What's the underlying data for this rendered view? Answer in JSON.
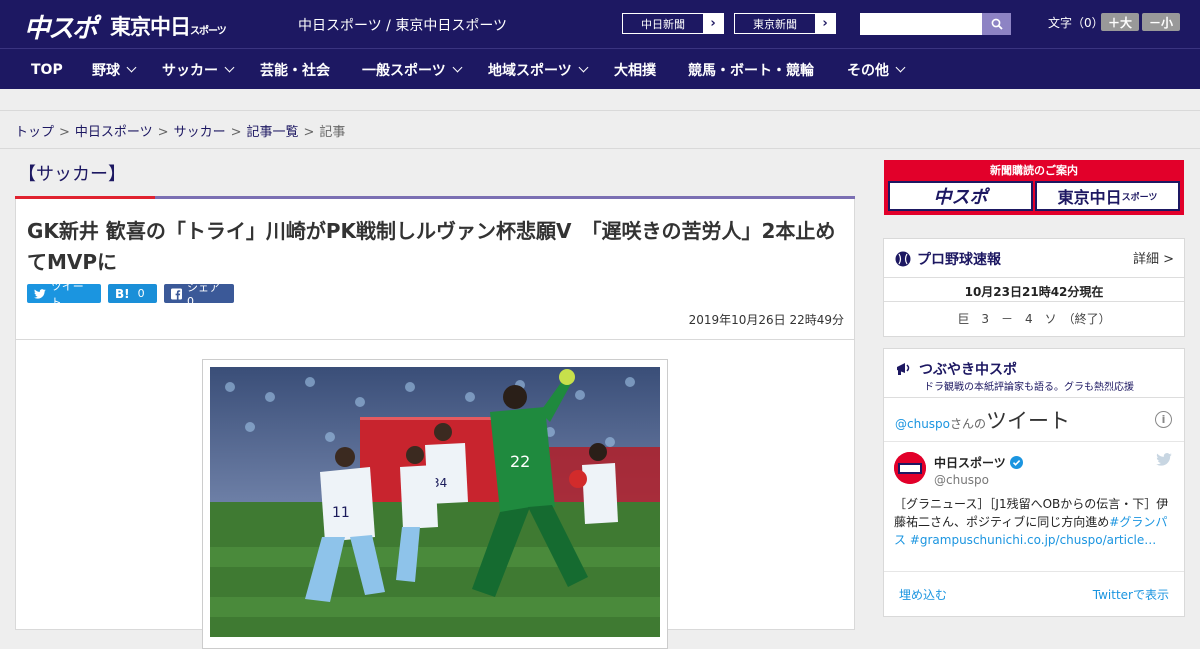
{
  "header": {
    "logo_chuspo": "中スポ",
    "logo_tokyo": "東京中日",
    "logo_tokyo_small": "スポーツ",
    "site_name": "中日スポーツ / 東京中日スポーツ",
    "ext_links": [
      {
        "label": "中日新聞"
      },
      {
        "label": "東京新聞"
      }
    ],
    "search_placeholder": "",
    "font_size_label": "文字（0）",
    "font_larger": "＋大",
    "font_smaller": "－小",
    "arrow_glyph": "›"
  },
  "nav": [
    {
      "label": "TOP",
      "has_menu": false
    },
    {
      "label": "野球",
      "has_menu": true
    },
    {
      "label": "サッカー",
      "has_menu": true
    },
    {
      "label": "芸能・社会",
      "has_menu": false
    },
    {
      "label": "一般スポーツ",
      "has_menu": true
    },
    {
      "label": "地域スポーツ",
      "has_menu": true
    },
    {
      "label": "大相撲",
      "has_menu": false
    },
    {
      "label": "競馬・ボート・競輪",
      "has_menu": false
    },
    {
      "label": "その他",
      "has_menu": true
    }
  ],
  "breadcrumb": {
    "items": [
      "トップ",
      "中日スポーツ",
      "サッカー",
      "記事一覧"
    ],
    "current": "記事",
    "separator": ">"
  },
  "article": {
    "category": "【サッカー】",
    "headline": "GK新井 歓喜の「トライ」川崎がPK戦制しルヴァン杯悲願V　「遅咲きの苦労人」2本止めてMVPに",
    "share": {
      "tweet": "ツイート",
      "hatena_count": "0",
      "facebook": "シェア 0"
    },
    "date": "2019年10月26日 22時49分"
  },
  "sidebar": {
    "ad": {
      "title": "新聞購読のご案内",
      "chuspo": "中スポ",
      "tokyo": "東京中日",
      "tokyo_small": "スポーツ"
    },
    "baseball": {
      "title": "プロ野球速報",
      "more": "詳細 >",
      "time": "10月23日21時42分現在",
      "score": "巨　3　－　4　ソ　（終了）"
    },
    "tweets": {
      "title": "つぶやき中スポ",
      "subtitle": "ドラ観戦の本紙評論家も語る。グラも熱烈応援",
      "handle_prefix": "@chuspo",
      "handle_suffix": "さんの",
      "big_label": "ツイート",
      "info_glyph": "i",
      "user_name": "中日スポーツ",
      "user_handle": "@chuspo",
      "text_plain": "［グラニュース］［J1残留へOBからの伝言・下］伊藤祐二さん、ポジティブに同じ方向進め",
      "text_link": "#グランパス #grampuschunichi.co.jp/chuspo/article…",
      "embed": "埋め込む",
      "view_on": "Twitterで表示"
    }
  },
  "colors": {
    "navy": "#1d1862",
    "red": "#e2002a",
    "twitter_blue": "#1b95e0"
  }
}
